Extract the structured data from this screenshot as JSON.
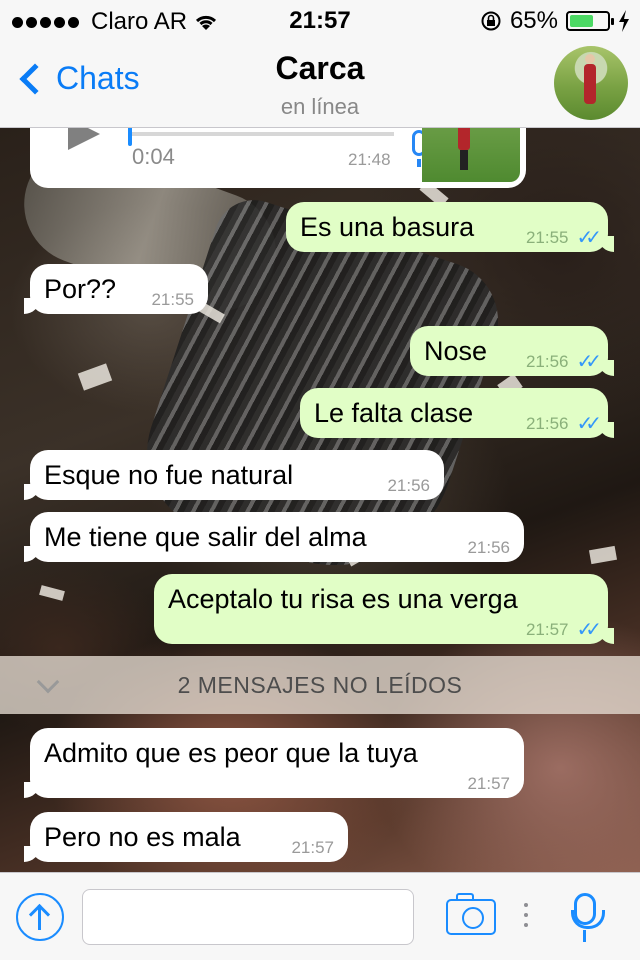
{
  "status_bar": {
    "carrier": "Claro AR",
    "time": "21:57",
    "battery_percent": "65%",
    "battery_level": 0.65
  },
  "nav": {
    "back_label": "Chats",
    "title": "Carca",
    "subtitle": "en línea"
  },
  "voice_message": {
    "duration": "0:04",
    "time": "21:48"
  },
  "messages": [
    {
      "dir": "out",
      "text": "Es una basura",
      "time": "21:55",
      "read": true
    },
    {
      "dir": "in",
      "text": "Por??",
      "time": "21:55"
    },
    {
      "dir": "out",
      "text": "Nose",
      "time": "21:56",
      "read": true
    },
    {
      "dir": "out",
      "text": "Le falta clase",
      "time": "21:56",
      "read": true
    },
    {
      "dir": "in",
      "text": "Esque no fue natural",
      "time": "21:56"
    },
    {
      "dir": "in",
      "text": "Me tiene que salir del alma",
      "time": "21:56"
    },
    {
      "dir": "out",
      "text": "Aceptalo tu risa es una verga",
      "time": "21:57",
      "read": true
    },
    {
      "dir": "in",
      "text": "Admito que es peor que la tuya",
      "time": "21:57"
    },
    {
      "dir": "in",
      "text": "Pero no es mala",
      "time": "21:57"
    }
  ],
  "unread_banner": "2 MENSAJES NO LEÍDOS",
  "input": {
    "value": "",
    "placeholder": ""
  },
  "colors": {
    "accent": "#1a8cff",
    "outgoing_bubble": "#e1fec6",
    "incoming_bubble": "#ffffff",
    "read_ticks": "#3497f9"
  },
  "icons": {
    "back": "chevron-left-icon",
    "share": "share-up-arrow-icon",
    "camera": "camera-icon",
    "mic": "microphone-icon",
    "play": "play-icon",
    "ticks": "double-check-icon"
  }
}
